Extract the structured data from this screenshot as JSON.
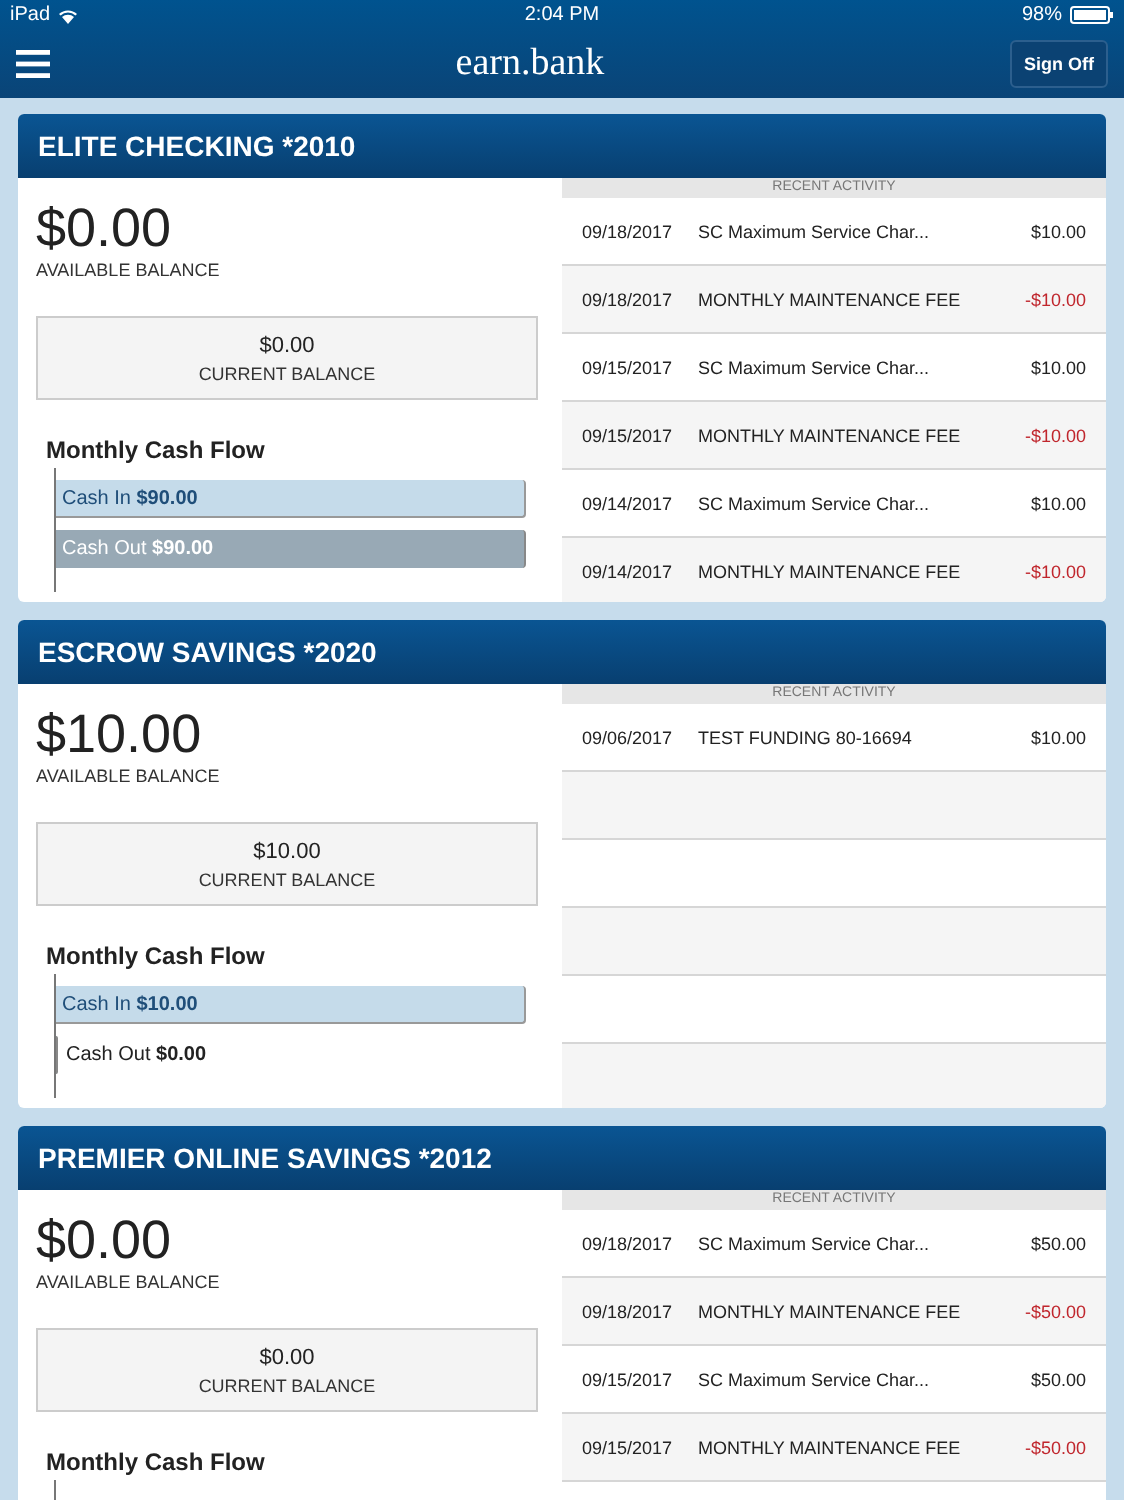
{
  "status_bar": {
    "device": "iPad",
    "time": "2:04 PM",
    "battery": "98%"
  },
  "nav": {
    "title": "earn.bank",
    "sign_off": "Sign Off"
  },
  "accounts": [
    {
      "title": "ELITE CHECKING *2010",
      "available": "$0.00",
      "available_label": "AVAILABLE BALANCE",
      "current": "$0.00",
      "current_label": "CURRENT BALANCE",
      "cash_flow_title": "Monthly Cash Flow",
      "bars": [
        {
          "kind": "in",
          "label": "Cash In **$90.00**",
          "level": 1
        },
        {
          "kind": "out",
          "label": "Cash Out **$90.00**",
          "level": 1
        }
      ],
      "activity_title": "RECENT ACTIVITY",
      "transactions": [
        {
          "date": "09/18/2017",
          "description": "SC Maximum Service Char...",
          "amount": "$10.00",
          "kind": "credit"
        },
        {
          "date": "09/18/2017",
          "description": "MONTHLY MAINTENANCE FEE",
          "amount": "-$10.00",
          "kind": "debit"
        },
        {
          "date": "09/15/2017",
          "description": "SC Maximum Service Char...",
          "amount": "$10.00",
          "kind": "credit"
        },
        {
          "date": "09/15/2017",
          "description": "MONTHLY MAINTENANCE FEE",
          "amount": "-$10.00",
          "kind": "debit"
        },
        {
          "date": "09/14/2017",
          "description": "SC Maximum Service Char...",
          "amount": "$10.00",
          "kind": "credit"
        },
        {
          "date": "09/14/2017",
          "description": "MONTHLY MAINTENANCE FEE",
          "amount": "-$10.00",
          "kind": "debit"
        }
      ]
    },
    {
      "title": "ESCROW SAVINGS *2020",
      "available": "$10.00",
      "available_label": "AVAILABLE BALANCE",
      "current": "$10.00",
      "current_label": "CURRENT BALANCE",
      "cash_flow_title": "Monthly Cash Flow",
      "bars": [
        {
          "kind": "in",
          "label": "Cash In **$10.00**",
          "level": 1
        },
        {
          "kind": "out",
          "label": "Cash Out **$0.00**",
          "level": 0
        }
      ],
      "activity_title": "RECENT ACTIVITY",
      "transactions": [
        {
          "date": "09/06/2017",
          "description": "TEST FUNDING 80-16694",
          "amount": "$10.00",
          "kind": "credit"
        }
      ]
    },
    {
      "title": "PREMIER ONLINE SAVINGS *2012",
      "available": "$0.00",
      "available_label": "AVAILABLE BALANCE",
      "current": "$0.00",
      "current_label": "CURRENT BALANCE",
      "cash_flow_title": "Monthly Cash Flow",
      "activity_title": "RECENT ACTIVITY",
      "transactions": [
        {
          "date": "09/18/2017",
          "description": "SC Maximum Service Char...",
          "amount": "$50.00",
          "kind": "credit"
        },
        {
          "date": "09/18/2017",
          "description": "MONTHLY MAINTENANCE FEE",
          "amount": "-$50.00",
          "kind": "debit"
        },
        {
          "date": "09/15/2017",
          "description": "SC Maximum Service Char...",
          "amount": "$50.00",
          "kind": "credit"
        },
        {
          "date": "09/15/2017",
          "description": "MONTHLY MAINTENANCE FEE",
          "amount": "-$50.00",
          "kind": "debit"
        }
      ]
    }
  ]
}
